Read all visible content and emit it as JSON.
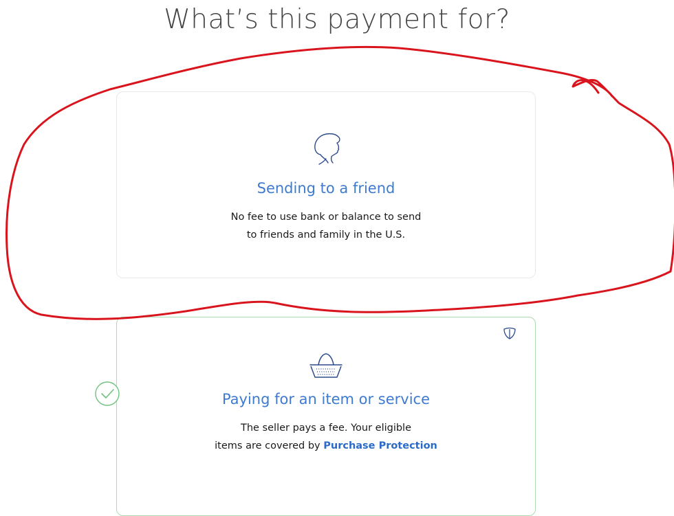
{
  "page": {
    "title": "What’s this payment for?"
  },
  "options": {
    "friend": {
      "title": "Sending to a friend",
      "desc_line1": "No fee to use bank or balance to send",
      "desc_line2": "to friends and family in the U.S.",
      "icon": "person-silhouette-icon"
    },
    "goods": {
      "title": "Paying for an item or service",
      "desc_line1": "The seller pays a fee. Your eligible",
      "desc_line2_prefix": "items are covered by",
      "desc_link": "Purchase Protection",
      "icon": "basket-icon",
      "badge_icon": "shield-icon",
      "selected": true
    }
  },
  "annotation": {
    "color": "#d9141d",
    "shape": "hand-drawn circle around Sending to a friend"
  },
  "colors": {
    "title_blue": "#3e7bd0",
    "selected_green": "#6fc27e"
  }
}
